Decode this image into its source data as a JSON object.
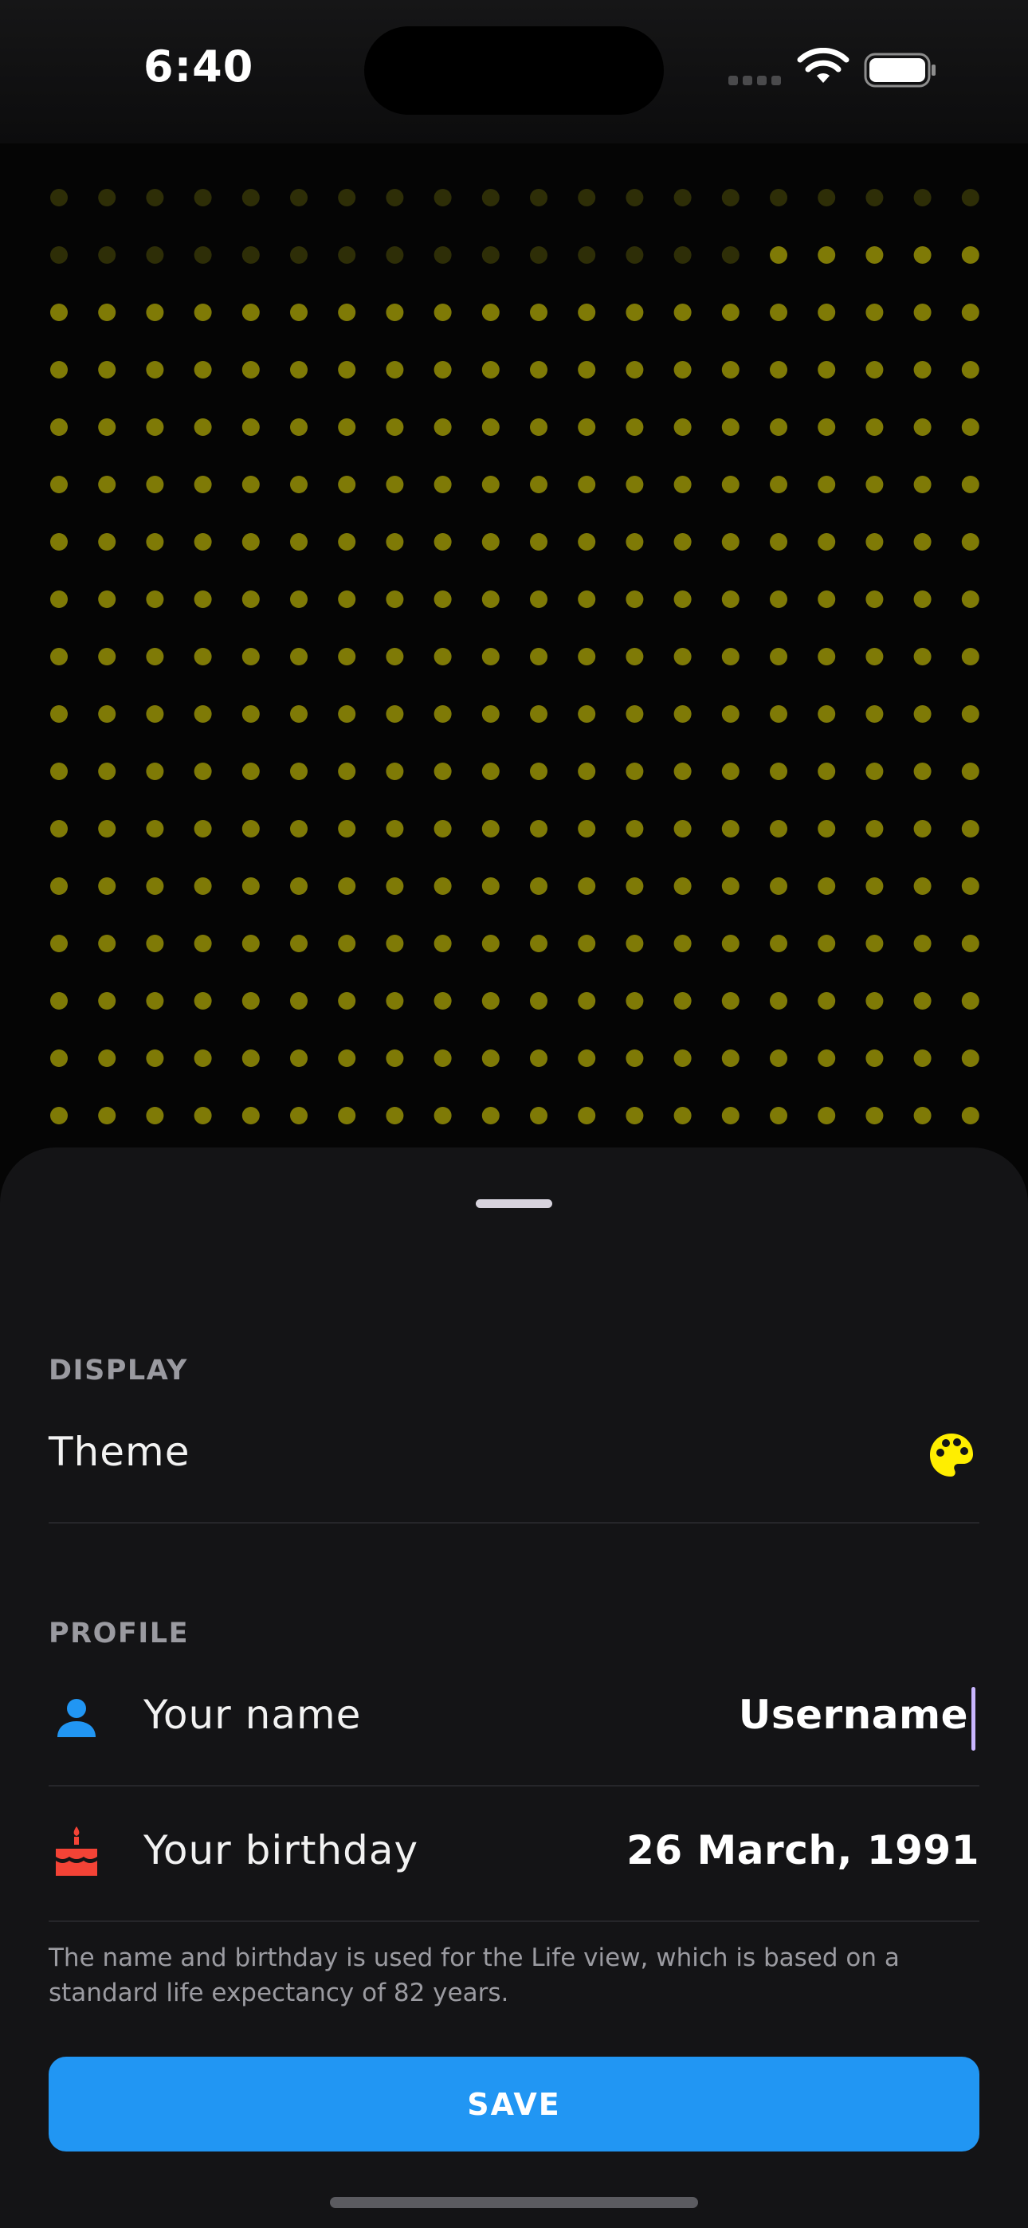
{
  "status_bar": {
    "time": "6:40",
    "battery_level": 1.0
  },
  "grid": {
    "columns": 20,
    "rows": 17,
    "elapsed_count": 35,
    "dot_color": "#7f7a06",
    "elapsed_color": "#2e2e07"
  },
  "display_section": {
    "title": "DISPLAY",
    "theme_label": "Theme",
    "theme_icon": "palette-icon",
    "accent_color": "#ffee00"
  },
  "profile_section": {
    "title": "PROFILE",
    "name_label": "Your name",
    "name_value": "Username",
    "name_icon": "person-icon",
    "birthday_label": "Your birthday",
    "birthday_value": "26 March, 1991",
    "birthday_icon": "cake-icon"
  },
  "footnote": "The name and birthday is used for the Life view, which is based on a standard life expectancy of 82 years.",
  "save_label": "SAVE",
  "colors": {
    "primary": "#2196f3",
    "sheet": "#141416",
    "person_icon": "#2196f3",
    "cake_icon": "#f44336"
  }
}
